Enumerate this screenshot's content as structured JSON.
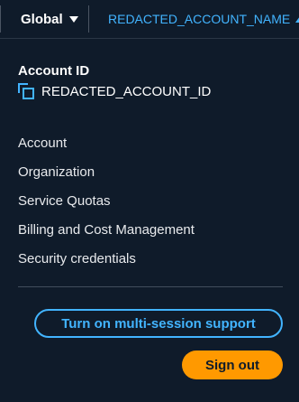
{
  "topbar": {
    "region_label": "Global",
    "region_icon": "caret-down-icon",
    "account_label": "REDACTED_ACCOUNT_NAME",
    "account_icon": "caret-up-icon"
  },
  "account_panel": {
    "account_id_title": "Account ID",
    "account_id_value": "REDACTED_ACCOUNT_ID",
    "copy_icon": "copy-icon",
    "menu_items": [
      {
        "label": "Account"
      },
      {
        "label": "Organization"
      },
      {
        "label": "Service Quotas"
      },
      {
        "label": "Billing and Cost Management"
      },
      {
        "label": "Security credentials"
      }
    ],
    "multi_session_label": "Turn on multi-session support",
    "sign_out_label": "Sign out"
  },
  "colors": {
    "background": "#0f1b2a",
    "link_blue": "#42b4ff",
    "sign_out_orange": "#ff9900",
    "divider": "#414d5c"
  }
}
